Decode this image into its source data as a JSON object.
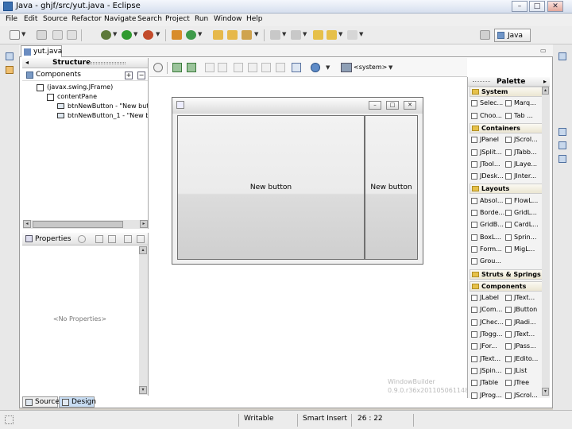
{
  "window": {
    "title": "Java - ghjf/src/yut.java - Eclipse",
    "controls": [
      "–",
      "□",
      "✕"
    ]
  },
  "menu": [
    "File",
    "Edit",
    "Source",
    "Refactor",
    "Navigate",
    "Search",
    "Project",
    "Run",
    "Window",
    "Help"
  ],
  "perspective": {
    "label": "Java"
  },
  "editor_tab": {
    "label": "yut.java",
    "close": "✕"
  },
  "structure": {
    "title": "Structure",
    "components_label": "Components",
    "tree": [
      {
        "label": "(javax.swing.JFrame)",
        "depth": 1
      },
      {
        "label": "contentPane",
        "depth": 2
      },
      {
        "label": "btnNewButton - \"New but",
        "depth": 3
      },
      {
        "label": "btnNewButton_1 - \"New b",
        "depth": 3
      }
    ]
  },
  "properties": {
    "title": "Properties",
    "empty_text": "<No Properties>"
  },
  "design_toolbar": {
    "system_label": "<system>"
  },
  "design": {
    "buttons": [
      {
        "label": "New button"
      },
      {
        "label": "New button"
      }
    ],
    "frame_controls": [
      "–",
      "□",
      "✕"
    ]
  },
  "watermark": {
    "line1": "WindowBuilder",
    "line2": "0.9.0.r36x201105061148"
  },
  "palette": {
    "title": "Palette",
    "sections": [
      {
        "name": "System",
        "items": [
          "Selec...",
          "Marq...",
          "Choo...",
          "Tab ..."
        ]
      },
      {
        "name": "Containers",
        "items": [
          "JPanel",
          "JScrol...",
          "JSplit...",
          "JTabb...",
          "JTool...",
          "JLaye...",
          "JDesk...",
          "JInter..."
        ]
      },
      {
        "name": "Layouts",
        "items": [
          "Absol...",
          "FlowL...",
          "Borde...",
          "GridL...",
          "GridB...",
          "CardL...",
          "BoxL...",
          "Sprin...",
          "Form...",
          "MigL...",
          "Grou..."
        ]
      },
      {
        "name": "Struts & Springs",
        "items": []
      },
      {
        "name": "Components",
        "items": [
          "JLabel",
          "JText...",
          "JCom...",
          "JButton",
          "JChec...",
          "JRadi...",
          "JTogg...",
          "JText...",
          "JFor...",
          "JPass...",
          "JText...",
          "JEdito...",
          "JSpin...",
          "JList",
          "JTable",
          "JTree",
          "JProg...",
          "JScrol..."
        ]
      }
    ]
  },
  "bottom_tabs": [
    {
      "label": "Source"
    },
    {
      "label": "Design"
    }
  ],
  "status": {
    "writable": "Writable",
    "insert_mode": "Smart Insert",
    "position": "26 : 22"
  },
  "colors": {
    "accent": "#3a6fb0",
    "selected_tab": "#c8ddf3"
  }
}
